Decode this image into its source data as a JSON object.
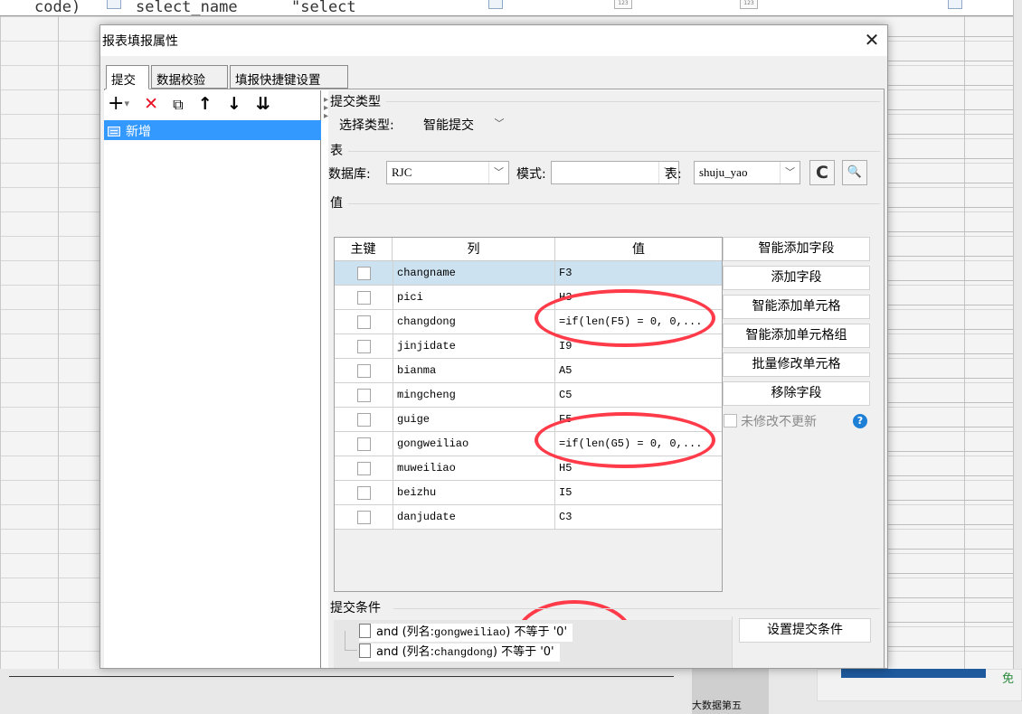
{
  "background_sheet": {
    "top_row_texts": [
      "code)",
      "select_name",
      "\"select"
    ]
  },
  "dialog": {
    "title": "报表填报属性",
    "close_glyph": "✕",
    "tabs": [
      {
        "label": "提交",
        "active": true
      },
      {
        "label": "数据校验",
        "active": false
      },
      {
        "label": "填报快捷键设置",
        "active": false
      }
    ],
    "toolbar": {
      "add": "+",
      "add_menu": "▾",
      "delete": "✕",
      "copy": "⧉",
      "up": "↑",
      "down": "↓",
      "sort": "⇊"
    },
    "tree": {
      "items": [
        {
          "label": "新增",
          "selected": true
        }
      ]
    },
    "submit_type": {
      "section": "提交类型",
      "label": "选择类型:",
      "value": "智能提交"
    },
    "table_section": {
      "section": "表",
      "database_label": "数据库:",
      "database_value": "RJC",
      "schema_label": "模式:",
      "schema_value": "",
      "table_label": "表:",
      "table_value": "shuju_yao",
      "refresh_glyph": "C",
      "preview_glyph": "🔍"
    },
    "value_section": {
      "section": "值",
      "headers": [
        "主键",
        "列",
        "值"
      ],
      "rows": [
        {
          "column": "changname",
          "value": "F3",
          "checked": false,
          "selected": true
        },
        {
          "column": "pici",
          "value": "H3",
          "checked": false
        },
        {
          "column": "changdong",
          "value": "=if(len(F5) = 0, 0,...",
          "checked": false
        },
        {
          "column": "jinjidate",
          "value": "I9",
          "checked": false
        },
        {
          "column": "bianma",
          "value": "A5",
          "checked": false
        },
        {
          "column": "mingcheng",
          "value": "C5",
          "checked": false
        },
        {
          "column": "guige",
          "value": "F5",
          "checked": false
        },
        {
          "column": "gongweiliao",
          "value": "=if(len(G5) = 0, 0,...",
          "checked": false
        },
        {
          "column": "muweiliao",
          "value": "H5",
          "checked": false
        },
        {
          "column": "beizhu",
          "value": "I5",
          "checked": false
        },
        {
          "column": "danjudate",
          "value": "C3",
          "checked": false
        }
      ]
    },
    "side_buttons": [
      "智能添加字段",
      "添加字段",
      "智能添加单元格",
      "智能添加单元格组",
      "批量修改单元格",
      "移除字段"
    ],
    "no_update_unmodified": {
      "label": "未修改不更新",
      "checked": false,
      "help": "?"
    },
    "submit_condition": {
      "section": "提交条件",
      "lines": [
        {
          "prefix": "and (列名:",
          "col": "gongweiliao",
          "suffix": ") 不等于 '0'"
        },
        {
          "prefix": "and (列名:",
          "col": "changdong",
          "suffix": ") 不等于 '0'"
        }
      ],
      "button": "设置提交条件"
    }
  },
  "bottom_bar": {
    "tab_label": "大数据第五",
    "free_label": "免"
  },
  "colors": {
    "highlight_ring": "#ff3b4a",
    "selection_blue": "#3399ff",
    "row_selected": "#cde2f0",
    "delete_red": "#e81123"
  }
}
